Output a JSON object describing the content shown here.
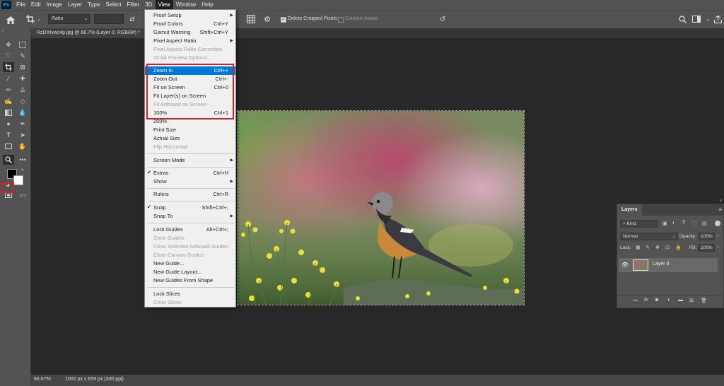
{
  "app": {
    "logo": "Ps"
  },
  "menubar": {
    "items": [
      "File",
      "Edit",
      "Image",
      "Layer",
      "Type",
      "Select",
      "Filter",
      "3D",
      "View",
      "Window",
      "Help"
    ]
  },
  "options": {
    "ratio_label": "Ratio",
    "delete_cropped_label": "Delete Cropped Pixels",
    "content_aware_label": "Content-Aware"
  },
  "document": {
    "tab_title": "RzDXtvwc4p.jpg @ 66.7% (Layer 0, RGB/8#) *"
  },
  "status": {
    "zoom": "66.67%",
    "doc_size": "1000 px x 659 px (300 ppi)"
  },
  "view_menu": {
    "items": [
      {
        "label": "Proof Setup",
        "shortcut": "",
        "disabled": false,
        "submenu": true
      },
      {
        "label": "Proof Colors",
        "shortcut": "Ctrl+Y",
        "disabled": false
      },
      {
        "label": "Gamut Warning",
        "shortcut": "Shift+Ctrl+Y",
        "disabled": false
      },
      {
        "label": "Pixel Aspect Ratio",
        "shortcut": "",
        "disabled": false,
        "submenu": true
      },
      {
        "label": "Pixel Aspect Ratio Correction",
        "shortcut": "",
        "disabled": true
      },
      {
        "label": "32-bit Preview Options...",
        "shortcut": "",
        "disabled": true
      },
      {
        "label": "Zoom In",
        "shortcut": "Ctrl++",
        "disabled": false,
        "highlighted": true
      },
      {
        "label": "Zoom Out",
        "shortcut": "Ctrl+-",
        "disabled": false
      },
      {
        "label": "Fit on Screen",
        "shortcut": "Ctrl+0",
        "disabled": false
      },
      {
        "label": "Fit Layer(s) on Screen",
        "shortcut": "",
        "disabled": false
      },
      {
        "label": "Fit Artboard on Screen",
        "shortcut": "",
        "disabled": true
      },
      {
        "label": "100%",
        "shortcut": "Ctrl+1",
        "disabled": false
      },
      {
        "label": "200%",
        "shortcut": "",
        "disabled": false
      },
      {
        "label": "Print Size",
        "shortcut": "",
        "disabled": false
      },
      {
        "label": "Actual Size",
        "shortcut": "",
        "disabled": false
      },
      {
        "label": "Flip Horizontal",
        "shortcut": "",
        "disabled": true
      },
      {
        "label": "Screen Mode",
        "shortcut": "",
        "disabled": false,
        "submenu": true
      },
      {
        "label": "Extras",
        "shortcut": "Ctrl+H",
        "disabled": false,
        "checked": true
      },
      {
        "label": "Show",
        "shortcut": "",
        "disabled": false,
        "submenu": true
      },
      {
        "label": "Rulers",
        "shortcut": "Ctrl+R",
        "disabled": false
      },
      {
        "label": "Snap",
        "shortcut": "Shift+Ctrl+;",
        "disabled": false,
        "checked": true
      },
      {
        "label": "Snap To",
        "shortcut": "",
        "disabled": false,
        "submenu": true
      },
      {
        "label": "Lock Guides",
        "shortcut": "Alt+Ctrl+;",
        "disabled": false
      },
      {
        "label": "Clear Guides",
        "shortcut": "",
        "disabled": true
      },
      {
        "label": "Clear Selected Artboard Guides",
        "shortcut": "",
        "disabled": true
      },
      {
        "label": "Clear Canvas Guides",
        "shortcut": "",
        "disabled": true
      },
      {
        "label": "New Guide...",
        "shortcut": "",
        "disabled": false
      },
      {
        "label": "New Guide Layout...",
        "shortcut": "",
        "disabled": false
      },
      {
        "label": "New Guides From Shape",
        "shortcut": "",
        "disabled": false
      },
      {
        "label": "Lock Slices",
        "shortcut": "",
        "disabled": false
      },
      {
        "label": "Clear Slices",
        "shortcut": "",
        "disabled": true
      }
    ]
  },
  "layers_panel": {
    "title": "Layers",
    "kind_label": "Kind",
    "blend_mode": "Normal",
    "opacity_label": "Opacity:",
    "opacity_value": "100%",
    "lock_label": "Lock:",
    "fill_label": "Fill:",
    "fill_value": "100%",
    "layers": [
      {
        "name": "Layer 0"
      }
    ]
  },
  "colors": {
    "accent": "#0078d7",
    "highlight_border": "#d0202a",
    "ui_bg": "#535353",
    "canvas_bg": "#282828"
  }
}
